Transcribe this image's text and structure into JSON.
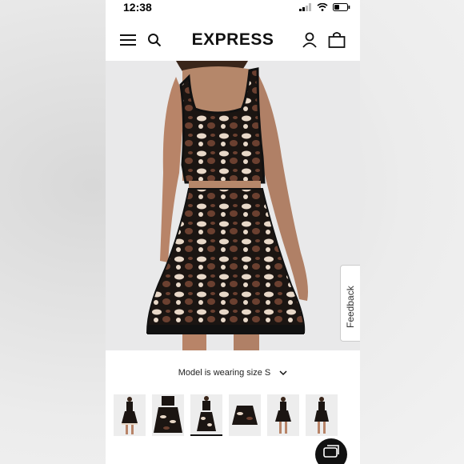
{
  "status_bar": {
    "time": "12:38"
  },
  "header": {
    "brand": "EXPRESS"
  },
  "product": {
    "size_note": "Model is wearing size S"
  },
  "feedback": {
    "label": "Feedback",
    "icon_text": "[+]"
  },
  "thumbnails": [
    {
      "name": "full-body-front"
    },
    {
      "name": "skirt-flat"
    },
    {
      "name": "back-view"
    },
    {
      "name": "skirt-detail"
    },
    {
      "name": "side-view"
    },
    {
      "name": "front-view"
    }
  ],
  "colors": {
    "accent": "#111111",
    "pattern_dark": "#1b1512",
    "pattern_brown": "#6b4030",
    "pattern_light": "#e8d8c8"
  },
  "icons": [
    "menu-icon",
    "search-icon",
    "account-icon",
    "bag-icon",
    "chevron-down-icon",
    "chat-icon"
  ]
}
